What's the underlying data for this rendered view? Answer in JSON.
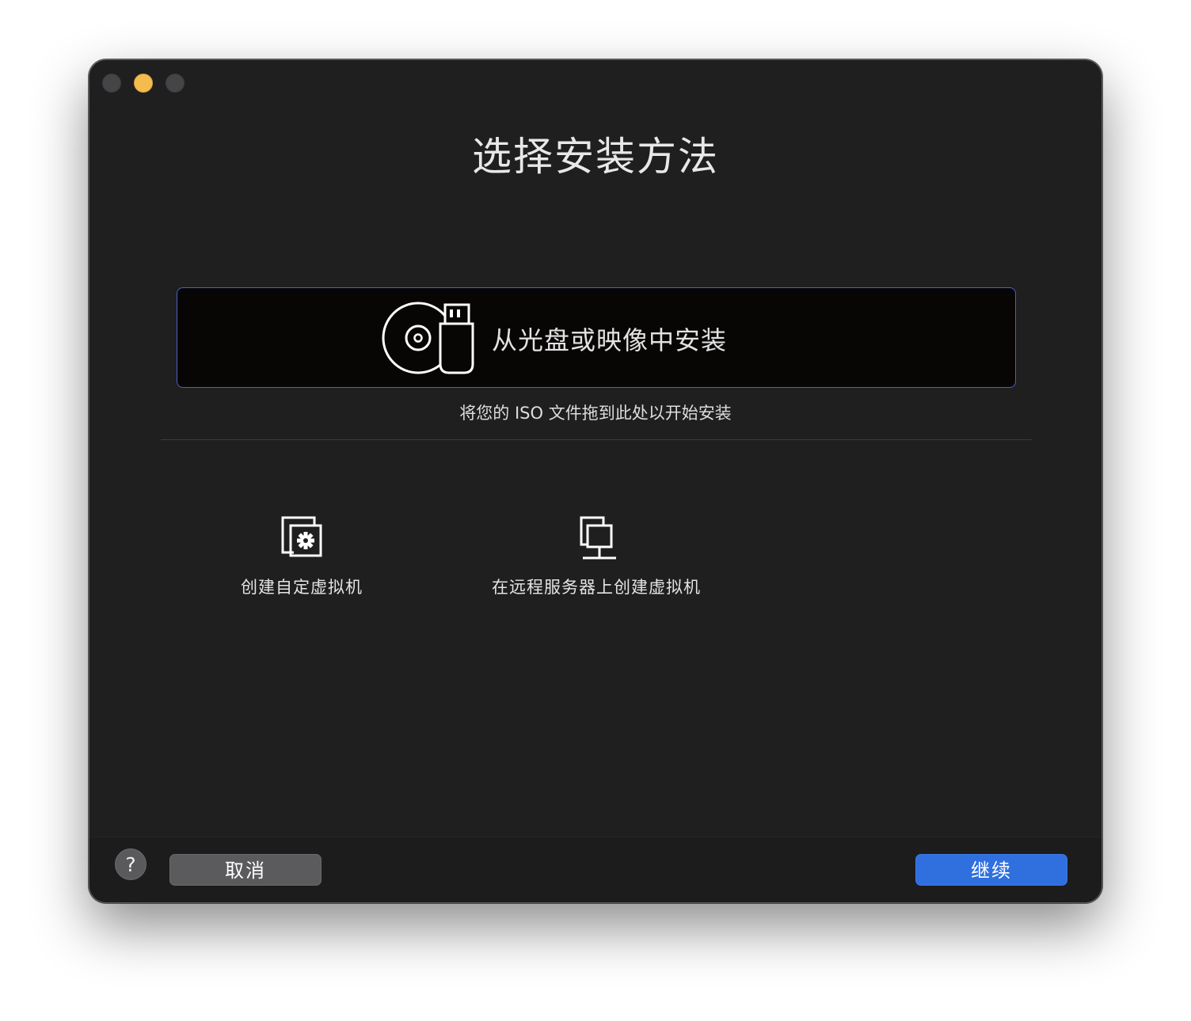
{
  "window": {
    "title": "选择安装方法"
  },
  "install_from_media": {
    "label": "从光盘或映像中安装",
    "hint": "将您的 ISO 文件拖到此处以开始安装",
    "icon": "disc-usb-icon"
  },
  "options": [
    {
      "label": "创建自定虚拟机",
      "icon": "custom-vm-gear-icon"
    },
    {
      "label": "在远程服务器上创建虚拟机",
      "icon": "remote-server-icon"
    }
  ],
  "footer": {
    "help_label": "?",
    "cancel_label": "取消",
    "continue_label": "继续"
  },
  "colors": {
    "accent": "#2f6fde",
    "selection_border": "#4a60c9",
    "window_bg": "#1f1f20"
  }
}
